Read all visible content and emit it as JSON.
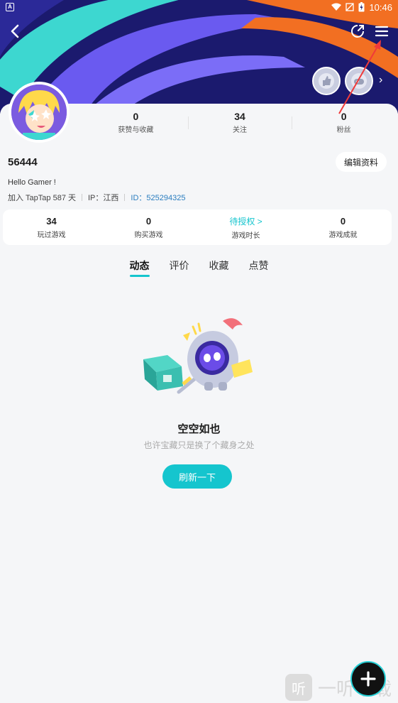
{
  "statusbar": {
    "time": "10:46",
    "left_icon": "a-icon"
  },
  "header": {
    "back_icon": "chevron-left-icon",
    "share_icon": "share-icon",
    "menu_icon": "menu-icon"
  },
  "colors": {
    "accent": "#15c5ce",
    "banner": "#1b1a6e",
    "link": "#2a7dbf"
  },
  "profile": {
    "stats": [
      {
        "value": "0",
        "label": "获赞与收藏"
      },
      {
        "value": "34",
        "label": "关注"
      },
      {
        "value": "0",
        "label": "粉丝"
      }
    ],
    "username": "56444",
    "edit_label": "编辑资料",
    "bio": "Hello Gamer !",
    "join_text": "加入 TapTap 587 天",
    "ip_text": "IP：江西",
    "id_text": "ID：525294325"
  },
  "game_stats": [
    {
      "value": "34",
      "label": "玩过游戏"
    },
    {
      "value": "0",
      "label": "购买游戏"
    },
    {
      "value": "待授权 >",
      "label": "游戏时长"
    },
    {
      "value": "0",
      "label": "游戏成就"
    }
  ],
  "tabs": [
    {
      "label": "动态",
      "active": true
    },
    {
      "label": "评价"
    },
    {
      "label": "收藏"
    },
    {
      "label": "点赞"
    }
  ],
  "empty": {
    "title": "空空如也",
    "subtitle": "也许宝藏只是换了个藏身之处",
    "refresh_label": "刷新一下"
  },
  "watermark": {
    "icon_text": "听",
    "text": "一听下载"
  }
}
